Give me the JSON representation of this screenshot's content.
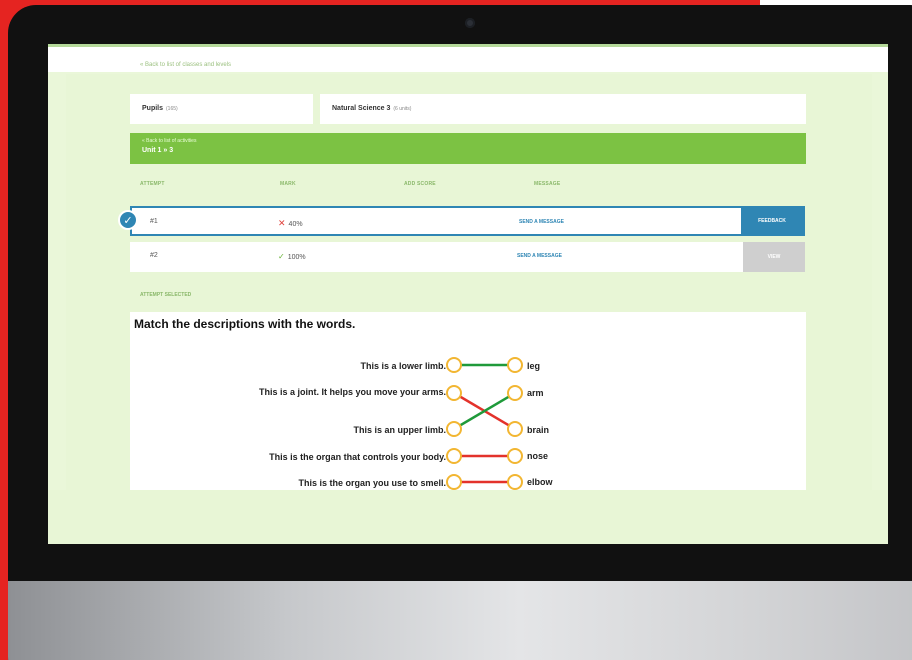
{
  "breadcrumb": "« Back to list of classes and levels",
  "header": {
    "pupils_label": "Pupils",
    "pupils_count": "(165)",
    "subject_label": "Natural Science 3",
    "subject_units": "(6 units)"
  },
  "activity_bar": {
    "back_label": "« Back to list of activities",
    "unit_title": "Unit 1 » 3"
  },
  "table": {
    "columns": [
      "ATTEMPT",
      "MARK",
      "ADD SCORE",
      "MESSAGE"
    ],
    "rows": [
      {
        "attempt": "#1",
        "mark": "40%",
        "mark_status": "wrong",
        "message": "SEND A MESSAGE",
        "action": "FEEDBACK",
        "selected": true
      },
      {
        "attempt": "#2",
        "mark": "100%",
        "mark_status": "correct",
        "message": "SEND A MESSAGE",
        "action": "VIEW",
        "selected": false
      }
    ]
  },
  "selected_label": "ATTEMPT SELECTED",
  "exercise": {
    "title": "Match the descriptions with the words.",
    "descriptions": [
      "This is a lower limb.",
      "This is a joint. It helps you move your arms.",
      "This is an upper limb.",
      "This is the organ that controls your body.",
      "This is the organ you use to smell."
    ],
    "words": [
      "leg",
      "arm",
      "brain",
      "nose",
      "elbow"
    ],
    "matches": [
      {
        "from": 0,
        "to": 0,
        "correct": true
      },
      {
        "from": 1,
        "to": 2,
        "correct": false
      },
      {
        "from": 2,
        "to": 1,
        "correct": true
      },
      {
        "from": 3,
        "to": 3,
        "correct": false
      },
      {
        "from": 4,
        "to": 4,
        "correct": false
      }
    ]
  },
  "colors": {
    "correct": "#1f9a3a",
    "wrong": "#e3322b",
    "accent_blue": "#2f86b4",
    "accent_green": "#7cc243",
    "node": "#f2b632"
  },
  "icons": {
    "selected": "check-icon",
    "wrong_mark": "cross-icon",
    "correct_mark": "tick-icon"
  }
}
